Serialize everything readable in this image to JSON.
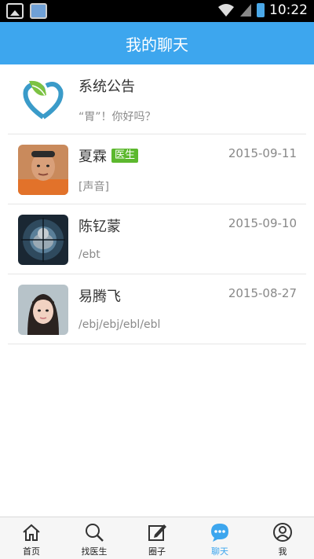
{
  "status_bar": {
    "time": "10:22"
  },
  "header": {
    "title": "我的聊天"
  },
  "chats": [
    {
      "name": "系统公告",
      "badge": "",
      "preview": "“胃”！你好吗？",
      "date": ""
    },
    {
      "name": "夏霖",
      "badge": "医生",
      "preview": "[声音]",
      "date": "2015-09-11"
    },
    {
      "name": "陈钇蒙",
      "badge": "",
      "preview": "/ebt",
      "date": "2015-09-10"
    },
    {
      "name": "易腾飞",
      "badge": "",
      "preview": "/ebj/ebj/ebl/ebl",
      "date": "2015-08-27"
    }
  ],
  "bottom_nav": [
    {
      "label": "首页",
      "icon": "home-icon"
    },
    {
      "label": "找医生",
      "icon": "search-icon"
    },
    {
      "label": "圈子",
      "icon": "edit-icon"
    },
    {
      "label": "聊天",
      "icon": "chat-icon",
      "active": true
    },
    {
      "label": "我",
      "icon": "profile-icon"
    }
  ],
  "colors": {
    "accent": "#3da6ee",
    "badge": "#5cb82e"
  }
}
